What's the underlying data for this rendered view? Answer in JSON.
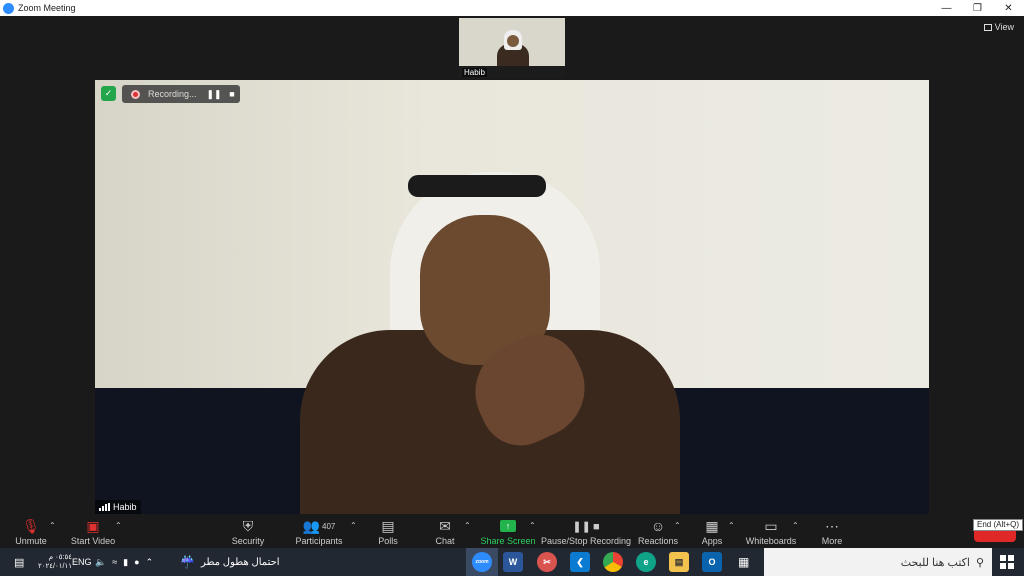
{
  "window": {
    "title": "Zoom Meeting",
    "minimize_icon": "minimize-icon",
    "restore_icon": "restore-icon",
    "close_icon": "close-icon"
  },
  "view": {
    "label": "View"
  },
  "thumbnail": {
    "name": "Habib"
  },
  "main_video": {
    "name": "Habib"
  },
  "recording": {
    "status": "Recording..."
  },
  "toolbar": {
    "unmute": "Unmute",
    "start_video": "Start Video",
    "security": "Security",
    "participants": "Participants",
    "participants_count": "407",
    "polls": "Polls",
    "chat": "Chat",
    "share_screen": "Share Screen",
    "pause_stop_recording": "Pause/Stop Recording",
    "reactions": "Reactions",
    "apps": "Apps",
    "whiteboards": "Whiteboards",
    "more": "More",
    "end_tooltip": "End (Alt+Q)"
  },
  "colors": {
    "share_green": "#23b34d",
    "end_red": "#e02828",
    "zoom_blue": "#2d8cff",
    "secure_green": "#23a54b"
  },
  "taskbar": {
    "time": "٠٥:٥٤ م",
    "date": "٢٠٢٤/٠١/١١",
    "language": "ENG",
    "weather": "احتمال هطول مطر",
    "search_placeholder": "اكتب هنا للبحث",
    "apps": [
      "zoom",
      "word",
      "snip",
      "vscode",
      "chrome",
      "edge",
      "files",
      "outlook"
    ]
  }
}
